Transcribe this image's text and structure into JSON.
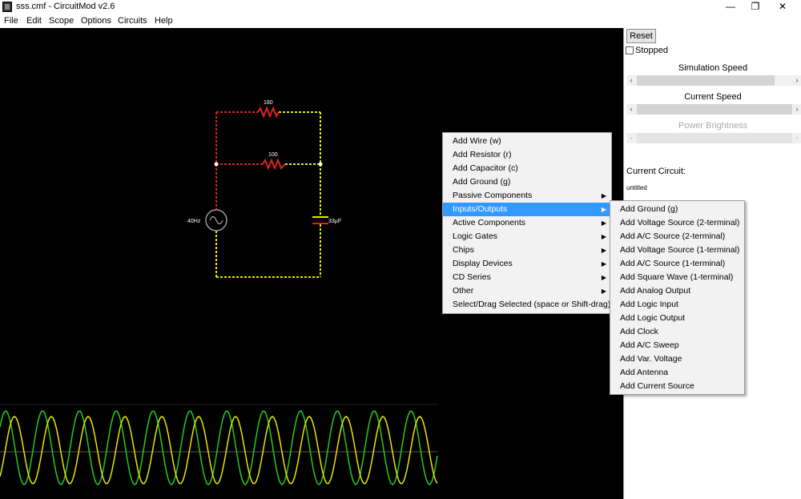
{
  "window": {
    "title": "sss.cmf - CircuitMod v2.6",
    "controls": [
      "—",
      "❐",
      "✕"
    ]
  },
  "menubar": [
    "File",
    "Edit",
    "Scope",
    "Options",
    "Circuits",
    "Help"
  ],
  "circuit": {
    "resistor_top": "180",
    "resistor_mid": "100",
    "source": "40Hz",
    "capacitor": "33µF"
  },
  "panel": {
    "reset": "Reset",
    "stopped": "Stopped",
    "simulation_speed": "Simulation Speed",
    "current_speed": "Current Speed",
    "power_brightness": "Power Brightness",
    "current_circuit": "Current Circuit:",
    "circuit_name": "untitled",
    "arrows": {
      "left": "‹",
      "right": "›"
    }
  },
  "context_menu": {
    "items": [
      {
        "label": "Add Wire (w)",
        "submenu": false
      },
      {
        "label": "Add Resistor (r)",
        "submenu": false
      },
      {
        "label": "Add Capacitor (c)",
        "submenu": false
      },
      {
        "label": "Add Ground (g)",
        "submenu": false
      },
      {
        "label": "Passive Components",
        "submenu": true
      },
      {
        "label": "Inputs/Outputs",
        "submenu": true,
        "highlighted": true
      },
      {
        "label": "Active Components",
        "submenu": true
      },
      {
        "label": "Logic Gates",
        "submenu": true
      },
      {
        "label": "Chips",
        "submenu": true
      },
      {
        "label": "Display Devices",
        "submenu": true
      },
      {
        "label": "CD Series",
        "submenu": true
      },
      {
        "label": "Other",
        "submenu": true
      },
      {
        "label": "Select/Drag Selected (space or Shift-drag)",
        "submenu": false
      }
    ],
    "submenu_arrow": "▶"
  },
  "submenu": {
    "items": [
      "Add Ground (g)",
      "Add Voltage Source (2-terminal)",
      "Add A/C Source (2-terminal)",
      "Add Voltage Source (1-terminal)",
      "Add A/C Source (1-terminal)",
      "Add Square Wave (1-terminal)",
      "Add Analog Output",
      "Add Logic Input",
      "Add Logic Output",
      "Add Clock",
      "Add A/C Sweep",
      "Add Var. Voltage",
      "Add Antenna",
      "Add Current Source"
    ]
  },
  "colors": {
    "wire_positive": "#e8e800",
    "wire_negative": "#dd2222",
    "scope_voltage": "#22cc22",
    "scope_current": "#e8e800",
    "highlight": "#3399ff"
  }
}
